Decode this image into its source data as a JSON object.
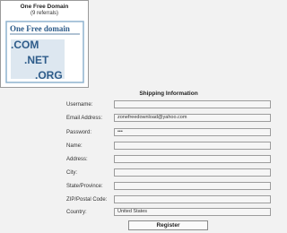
{
  "promo": {
    "title": "One Free Domain",
    "subtitle": "(9 referrals)",
    "logo": {
      "name": "One Free domain",
      "lines": [
        ".COM",
        ".NET",
        ".ORG"
      ],
      "colors": {
        "text": "#2e5c8a",
        "frame": "#8fb3cf",
        "panel": "#dde7f0"
      }
    }
  },
  "form": {
    "title": "Shipping Information",
    "fields": [
      {
        "label": "Username:",
        "value": ""
      },
      {
        "label": "Email Address:",
        "value": "zonefreedownload@yahoo.com"
      },
      {
        "label": "Password:",
        "value": "•••"
      },
      {
        "label": "Name:",
        "value": ""
      },
      {
        "label": "Address:",
        "value": ""
      },
      {
        "label": "City:",
        "value": ""
      },
      {
        "label": "State/Province:",
        "value": ""
      },
      {
        "label": "ZIP/Postal Code:",
        "value": ""
      },
      {
        "label": "Country:",
        "value": "United States"
      }
    ],
    "register_label": "Register"
  }
}
